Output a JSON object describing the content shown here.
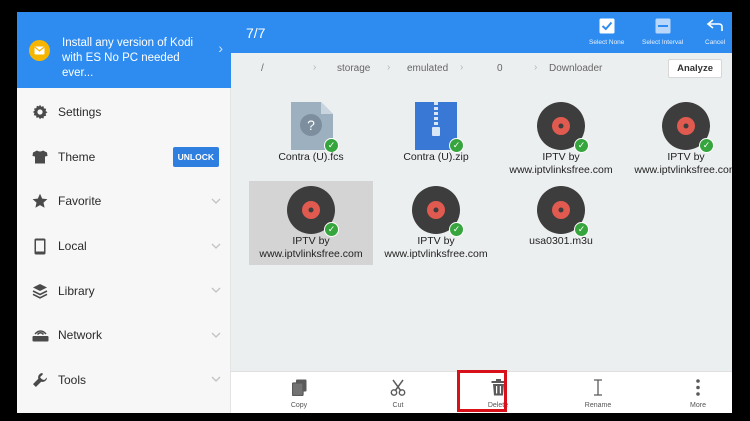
{
  "sidebar": {
    "promo": {
      "text": "Install any version of Kodi with ES No PC needed ever...",
      "icon": "mail-icon"
    },
    "items": [
      {
        "label": "Settings",
        "icon": "gear-icon"
      },
      {
        "label": "Theme",
        "icon": "shirt-icon",
        "badge": "UNLOCK"
      },
      {
        "label": "Favorite",
        "icon": "star-icon"
      },
      {
        "label": "Local",
        "icon": "phone-icon"
      },
      {
        "label": "Library",
        "icon": "layers-icon"
      },
      {
        "label": "Network",
        "icon": "router-icon"
      },
      {
        "label": "Tools",
        "icon": "wrench-icon"
      }
    ]
  },
  "header": {
    "count": "7/7",
    "actions": [
      {
        "label": "Select None",
        "icon": "checkbox-icon"
      },
      {
        "label": "Select Interval",
        "icon": "interval-icon"
      },
      {
        "label": "Cancel",
        "icon": "return-icon"
      }
    ]
  },
  "breadcrumb": {
    "segments": [
      "/",
      "storage",
      "emulated",
      "0",
      "Downloader"
    ],
    "analyze_label": "Analyze"
  },
  "files": [
    {
      "name": "Contra (U).fcs",
      "type": "unknown",
      "selected": false
    },
    {
      "name": "Contra (U).zip",
      "type": "zip",
      "selected": false
    },
    {
      "name": "IPTV by www.iptvlinksfree.com",
      "type": "media",
      "selected": false
    },
    {
      "name": "IPTV by www.iptvlinksfree.com",
      "type": "media",
      "selected": false
    },
    {
      "name": "IPTV by www.iptvlinksfree.com",
      "type": "media",
      "selected": true
    },
    {
      "name": "IPTV by www.iptvlinksfree.com",
      "type": "media",
      "selected": false
    },
    {
      "name": "usa0301.m3u",
      "type": "media",
      "selected": false
    }
  ],
  "toolbar": {
    "items": [
      {
        "label": "Copy",
        "icon": "copy-icon"
      },
      {
        "label": "Cut",
        "icon": "scissors-icon"
      },
      {
        "label": "Delete",
        "icon": "trash-icon"
      },
      {
        "label": "Rename",
        "icon": "text-cursor-icon"
      },
      {
        "label": "More",
        "icon": "more-vertical-icon"
      }
    ]
  },
  "colors": {
    "accent": "#2e8cf0",
    "promo_icon": "#f6b600",
    "check": "#37a53d",
    "highlight": "#d7101a",
    "media_disc": "#3d3d3d",
    "media_center": "#e05a4f"
  }
}
